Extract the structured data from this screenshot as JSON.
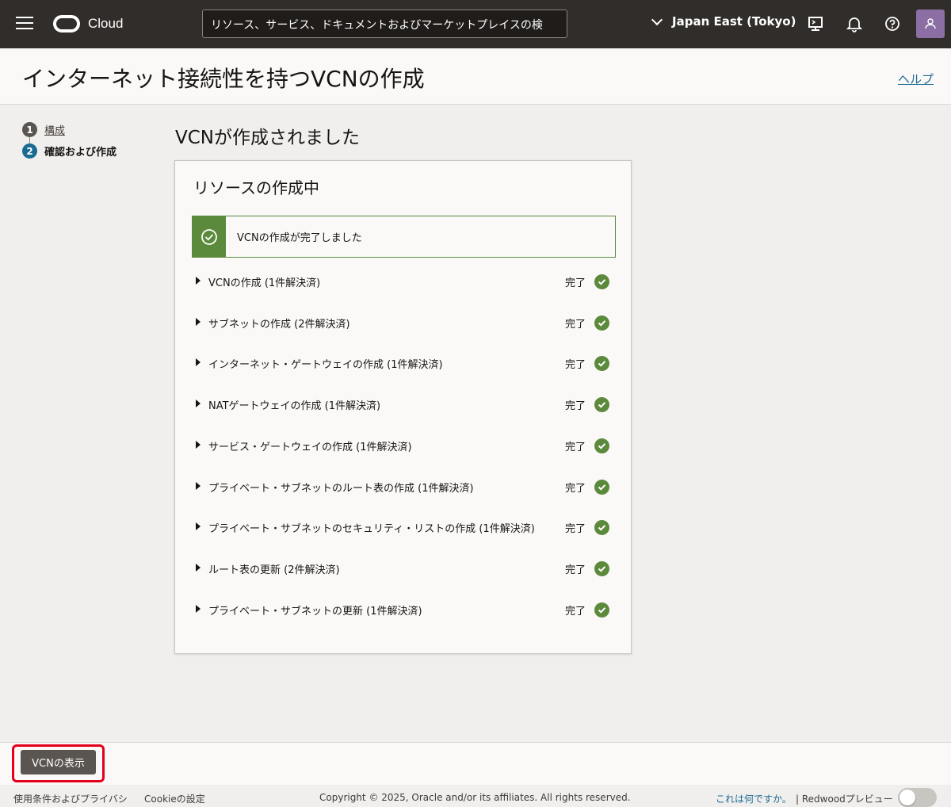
{
  "topbar": {
    "logo_text": "Cloud",
    "search_placeholder": "リソース、サービス、ドキュメントおよびマーケットプレイスの検",
    "region": "Japan East (Tokyo)"
  },
  "page": {
    "title": "インターネット接続性を持つVCNの作成",
    "help": "ヘルプ"
  },
  "steps": [
    {
      "num": "1",
      "label": "構成"
    },
    {
      "num": "2",
      "label": "確認および作成"
    }
  ],
  "section_title": "VCNが作成されました",
  "card": {
    "title": "リソースの作成中",
    "banner": "VCNの作成が完了しました",
    "tasks": [
      {
        "name": "VCNの作成 (1件解決済)",
        "status": "完了"
      },
      {
        "name": "サブネットの作成 (2件解決済)",
        "status": "完了"
      },
      {
        "name": "インターネット・ゲートウェイの作成 (1件解決済)",
        "status": "完了"
      },
      {
        "name": "NATゲートウェイの作成 (1件解決済)",
        "status": "完了"
      },
      {
        "name": "サービス・ゲートウェイの作成 (1件解決済)",
        "status": "完了"
      },
      {
        "name": "プライベート・サブネットのルート表の作成 (1件解決済)",
        "status": "完了"
      },
      {
        "name": "プライベート・サブネットのセキュリティ・リストの作成 (1件解決済)",
        "status": "完了"
      },
      {
        "name": "ルート表の更新 (2件解決済)",
        "status": "完了"
      },
      {
        "name": "プライベート・サブネットの更新 (1件解決済)",
        "status": "完了"
      }
    ]
  },
  "bottom": {
    "view_button": "VCNの表示"
  },
  "footer": {
    "terms": "使用条件およびプライバシ",
    "cookie": "Cookieの設定",
    "copyright": "Copyright © 2025, Oracle and/or its affiliates. All rights reserved.",
    "what": "これは何ですか。",
    "redwood": "| Redwoodプレビュー"
  },
  "colors": {
    "topbar": "#312d2a",
    "success": "#5c8a3c",
    "link": "#1a6b93",
    "highlight": "#e3001b"
  }
}
